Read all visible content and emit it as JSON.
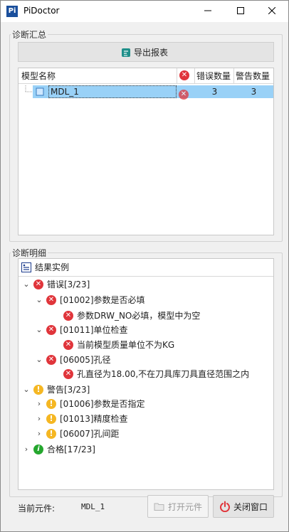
{
  "window": {
    "icon_text": "Pi",
    "title": "PiDoctor",
    "min_glyph": "—",
    "max_glyph": "☐",
    "close_glyph": "✕"
  },
  "summary": {
    "group_title": "诊断汇总",
    "export_label": "导出报表",
    "columns": {
      "model_name": "模型名称",
      "errors": "错误数量",
      "warnings": "警告数量"
    },
    "rows": [
      {
        "name": "MDL_1",
        "errors": "3",
        "warnings": "3"
      }
    ]
  },
  "detail": {
    "group_title": "诊断明细",
    "header_label": "结果实例",
    "tree": {
      "errors": {
        "label": "错误[3/23]",
        "children": [
          {
            "label": "[01002]参数是否必填",
            "message": "参数DRW_NO必填，模型中为空"
          },
          {
            "label": "[01011]单位检查",
            "message": "当前模型质量单位不为KG"
          },
          {
            "label": "[06005]孔径",
            "message": "孔直径为18.00,不在刀具库刀具直径范围之内"
          }
        ]
      },
      "warnings": {
        "label": "警告[3/23]",
        "children": [
          {
            "label": "[01006]参数是否指定"
          },
          {
            "label": "[01013]精度检查"
          },
          {
            "label": "[06007]孔间距"
          }
        ]
      },
      "passed": {
        "label": "合格[17/23]"
      }
    }
  },
  "footer": {
    "current_label": "当前元件:",
    "current_value": "MDL_1",
    "open_label": "打开元件",
    "close_label": "关闭窗口"
  }
}
